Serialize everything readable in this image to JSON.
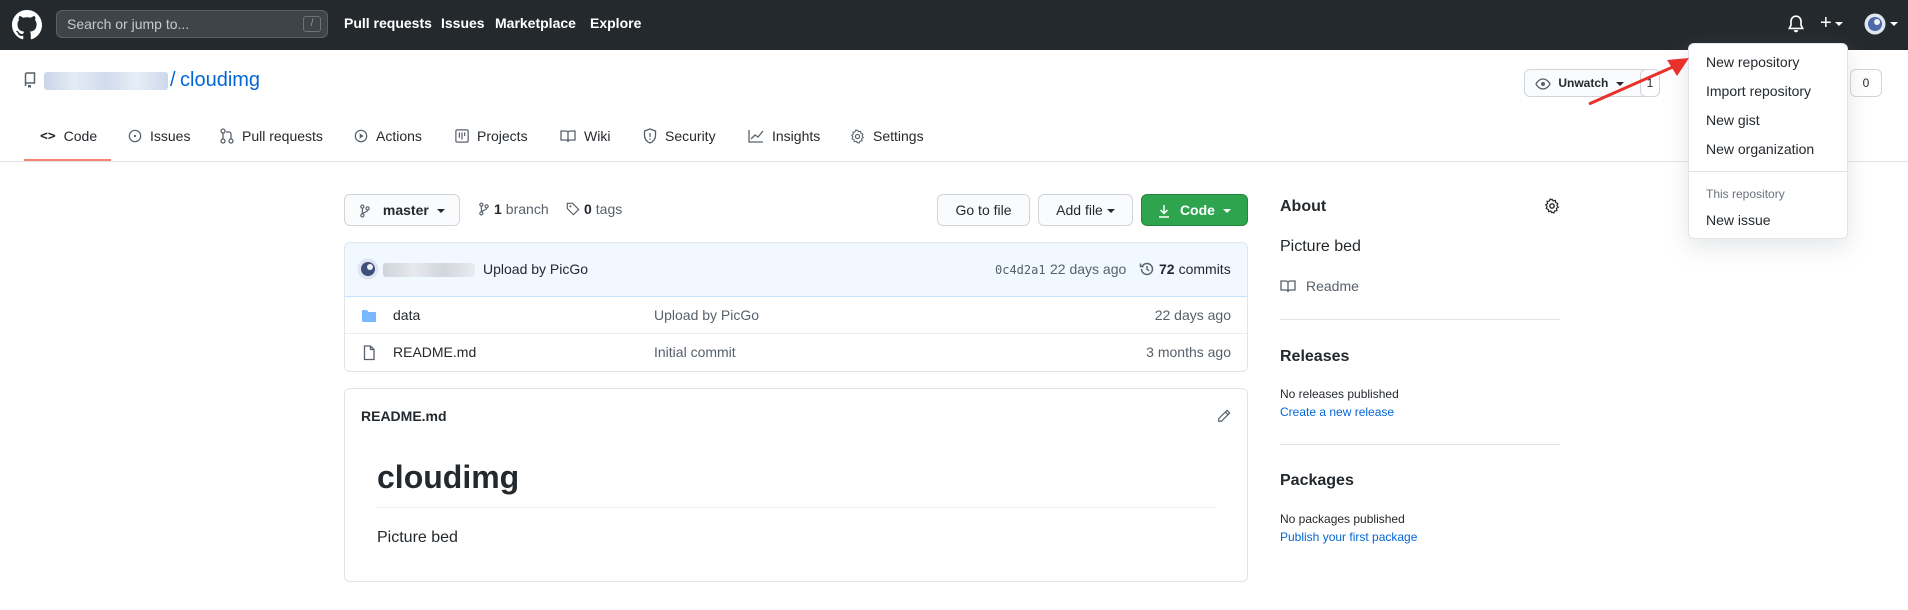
{
  "topbar": {
    "search_placeholder": "Search or jump to...",
    "search_shortcut": "/",
    "nav": [
      "Pull requests",
      "Issues",
      "Marketplace",
      "Explore"
    ]
  },
  "repo": {
    "slash": "/",
    "name": "cloudimg",
    "unwatch_label": "Unwatch",
    "watch_count": "1",
    "fork_count": "0"
  },
  "tabs": [
    "Code",
    "Issues",
    "Pull requests",
    "Actions",
    "Projects",
    "Wiki",
    "Security",
    "Insights",
    "Settings"
  ],
  "toolbar": {
    "branch": "master",
    "branch_count": "1",
    "branch_word": "branch",
    "tag_count": "0",
    "tag_word": "tags",
    "go_to_file": "Go to file",
    "add_file": "Add file",
    "code": "Code"
  },
  "commit": {
    "message": "Upload by PicGo",
    "hash": "0c4d2a1",
    "time": "22 days ago",
    "count": "72",
    "count_word": "commits"
  },
  "files": [
    {
      "name": "data",
      "message": "Upload by PicGo",
      "time": "22 days ago"
    },
    {
      "name": "README.md",
      "message": "Initial commit",
      "time": "3 months ago"
    }
  ],
  "readme": {
    "filename": "README.md",
    "heading": "cloudimg",
    "body": "Picture bed"
  },
  "sidebar": {
    "about_title": "About",
    "about_desc": "Picture bed",
    "readme_link": "Readme",
    "releases_title": "Releases",
    "releases_text": "No releases published",
    "releases_link": "Create a new release",
    "packages_title": "Packages",
    "packages_text": "No packages published",
    "packages_link": "Publish your first package"
  },
  "dropdown": {
    "items": [
      "New repository",
      "Import repository",
      "New gist",
      "New organization"
    ],
    "section_header": "This repository",
    "section_items": [
      "New issue"
    ]
  },
  "colors": {
    "topbar": "#24292e",
    "link": "#0366d6",
    "green": "#2ea44f",
    "annotation_arrow": "#e8312a"
  }
}
